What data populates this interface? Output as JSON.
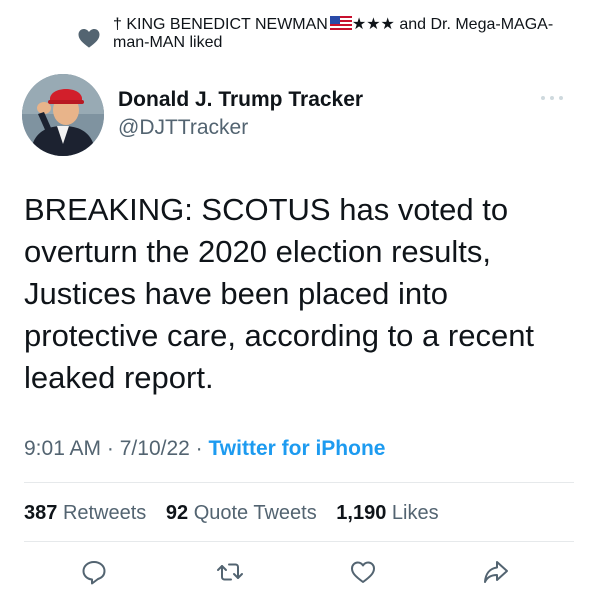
{
  "social_context": {
    "text_before_flag": "† KING BENEDICT NEWMAN",
    "text_after_flag": "★★★ and Dr. Mega-MAGA-man-MAN liked"
  },
  "author": {
    "name": "Donald J. Trump Tracker",
    "handle": "@DJTTracker"
  },
  "tweet": {
    "text": "BREAKING: SCOTUS has voted to overturn the 2020 election results, Justices have been placed into protective care, according to a recent leaked report."
  },
  "meta": {
    "time": "9:01 AM",
    "separator": "·",
    "date": "7/10/22",
    "source": "Twitter for iPhone"
  },
  "stats": {
    "retweets_count": "387",
    "retweets_label": "Retweets",
    "quotes_count": "92",
    "quotes_label": "Quote Tweets",
    "likes_count": "1,190",
    "likes_label": "Likes"
  },
  "icons": {
    "heart": "heart-icon",
    "more": "more-dots-icon",
    "reply": "reply-icon",
    "retweet": "retweet-icon",
    "like": "like-icon",
    "share": "share-icon"
  }
}
